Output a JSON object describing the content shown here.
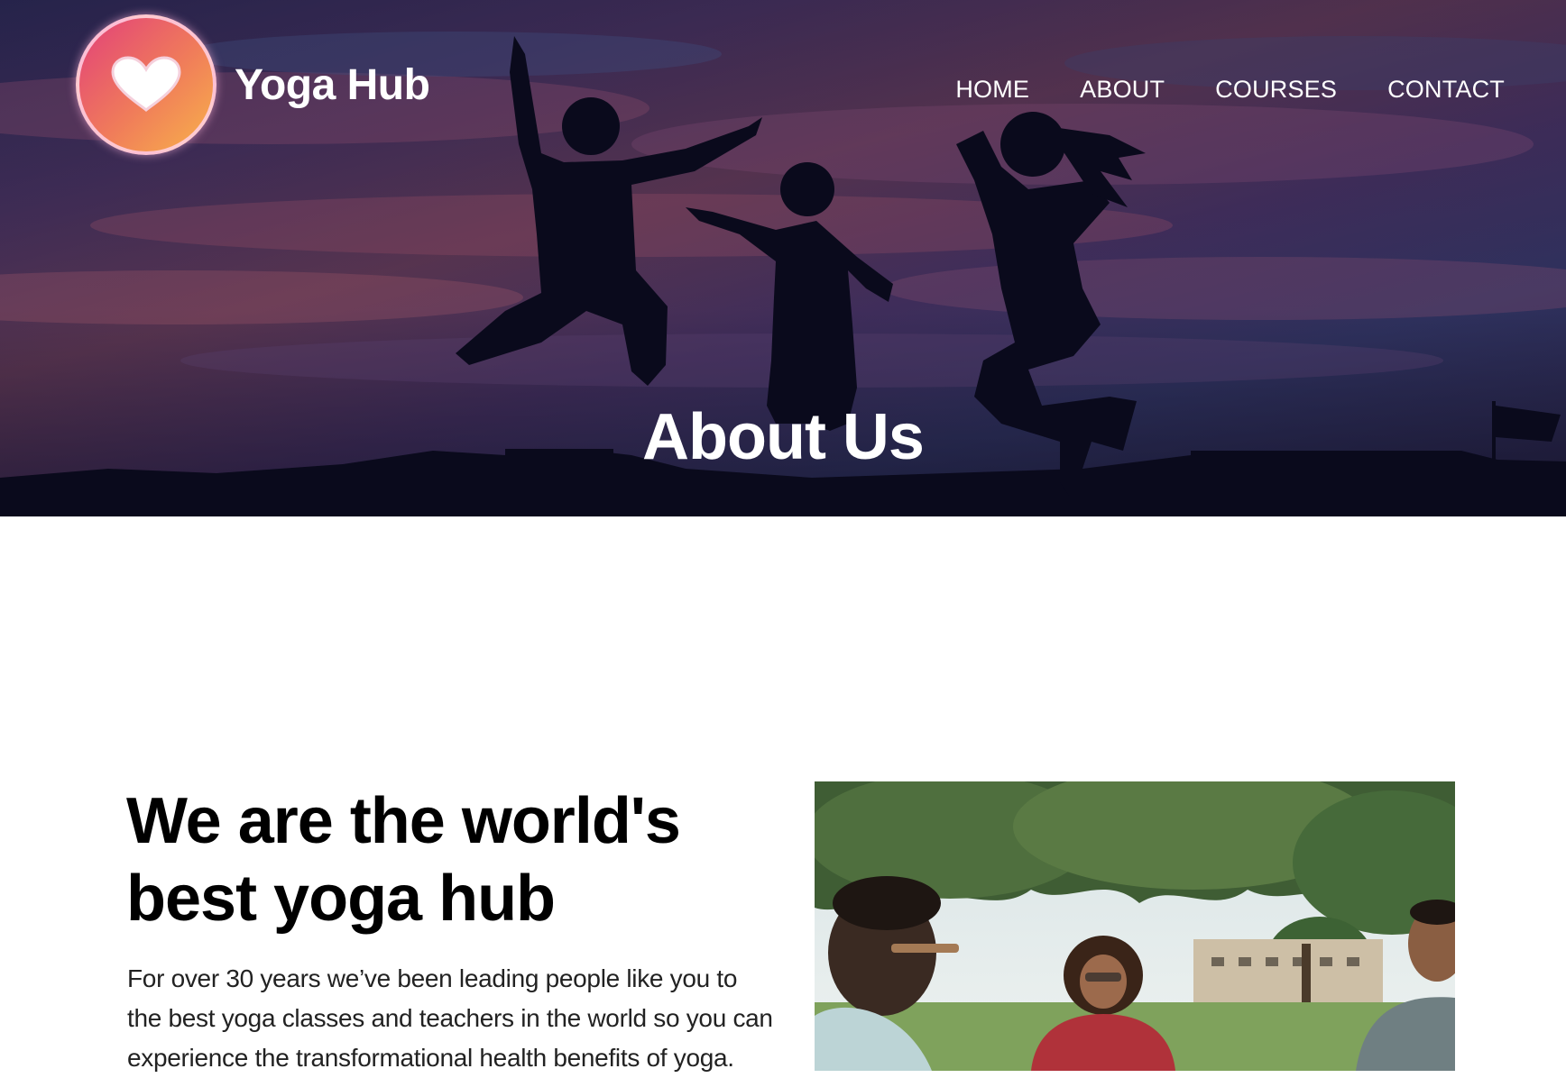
{
  "brand": {
    "name": "Yoga Hub",
    "logo_icon": "heart-icon",
    "logo_colors": [
      "#e2407a",
      "#f8b24a"
    ]
  },
  "nav": {
    "items": [
      {
        "label": "HOME"
      },
      {
        "label": "ABOUT"
      },
      {
        "label": "COURSES"
      },
      {
        "label": "CONTACT"
      }
    ]
  },
  "hero": {
    "title": "About Us"
  },
  "about": {
    "heading_line1": "We are the world's",
    "heading_line2": "best yoga hub",
    "paragraph": "For over 30 years we’ve been leading people like you to the best yoga classes and teachers in the world so you can experience the transformational health benefits of yoga."
  }
}
